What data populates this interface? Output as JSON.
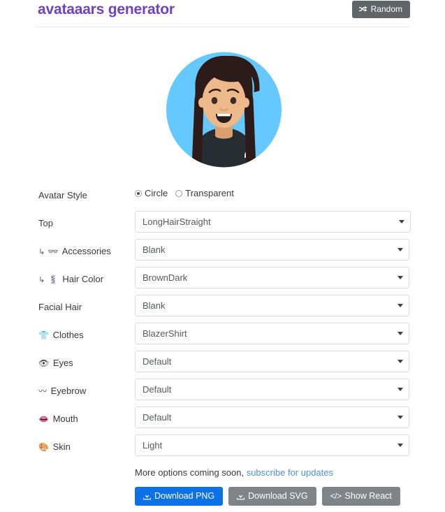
{
  "header": {
    "title": "avataaars generator",
    "random_button": {
      "label": "Random",
      "icon": "shuffle-icon"
    },
    "title_color": "#6f42c1",
    "button_color": "#5f6569"
  },
  "avatar": {
    "alt": "avatar-preview",
    "background_color": "#65c9ff",
    "hair_color": "#2c1b18",
    "skin_color": "#edb98a",
    "clothes_color": "#262e33",
    "style": "Circle",
    "top": "LongHairStraight",
    "clothes": "BlazerShirt",
    "eyes": "Default",
    "eyebrow": "Default",
    "mouth": "Default",
    "skin": "Light"
  },
  "form": {
    "avatar_style": {
      "label": "Avatar Style",
      "options": [
        {
          "label": "Circle",
          "selected": true
        },
        {
          "label": "Transparent",
          "selected": false
        }
      ]
    },
    "fields": [
      {
        "icon": "",
        "arrow": "",
        "label": "Top",
        "value": "LongHairStraight",
        "name": "top"
      },
      {
        "icon": "👓",
        "arrow": "↳",
        "label": "Accessories",
        "value": "Blank",
        "name": "accessories"
      },
      {
        "icon": "💈",
        "arrow": "↳",
        "label": "Hair Color",
        "value": "BrownDark",
        "name": "hair-color"
      },
      {
        "icon": "",
        "arrow": "",
        "label": "Facial Hair",
        "value": "Blank",
        "name": "facial-hair"
      },
      {
        "icon": "👕",
        "arrow": "",
        "label": "Clothes",
        "value": "BlazerShirt",
        "name": "clothes"
      },
      {
        "icon": "👁",
        "arrow": "",
        "label": "Eyes",
        "value": "Default",
        "name": "eyes"
      },
      {
        "icon": "〰",
        "arrow": "",
        "label": "Eyebrow",
        "value": "Default",
        "name": "eyebrow"
      },
      {
        "icon": "👄",
        "arrow": "",
        "label": "Mouth",
        "value": "Default",
        "name": "mouth"
      },
      {
        "icon": "🎨",
        "arrow": "",
        "label": "Skin",
        "value": "Light",
        "name": "skin"
      }
    ]
  },
  "footer": {
    "note_text": "More options coming soon, ",
    "note_link": "subscribe for updates",
    "buttons": [
      {
        "label": "Download PNG",
        "icon": "download-icon",
        "style": "primary"
      },
      {
        "label": "Download SVG",
        "icon": "download-icon",
        "style": "secondary"
      },
      {
        "label": "Show React",
        "icon": "code-icon",
        "style": "secondary"
      }
    ]
  }
}
